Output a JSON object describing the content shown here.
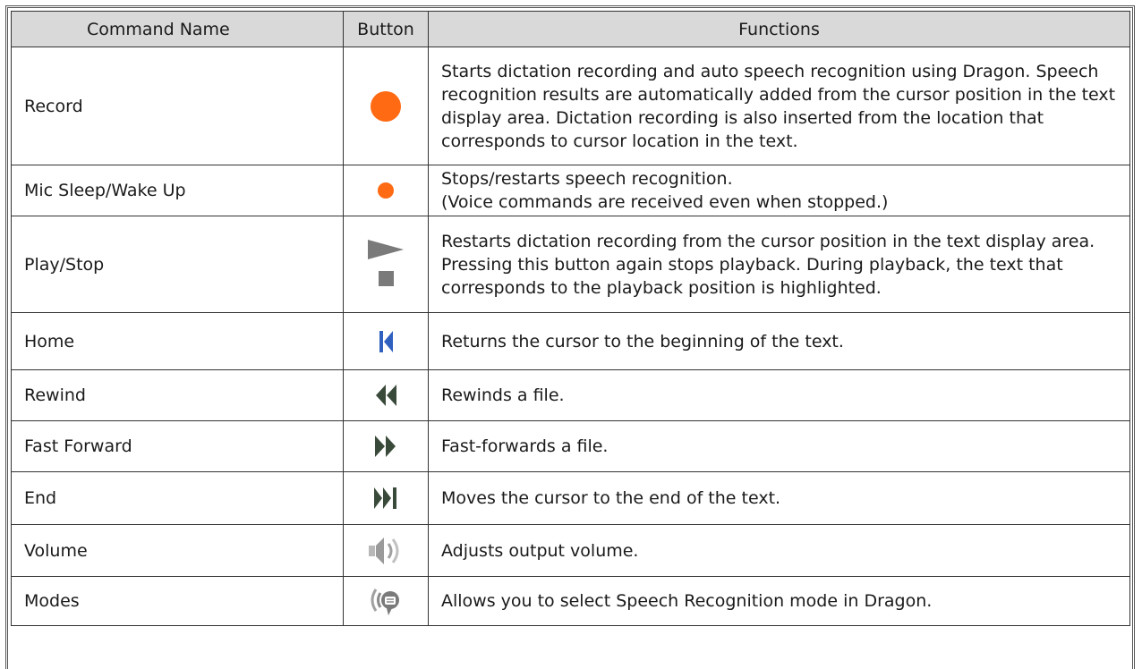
{
  "headers": {
    "command_name": "Command Name",
    "button": "Button",
    "functions": "Functions"
  },
  "rows": [
    {
      "name": "Record",
      "icon": "record-icon",
      "function": "Starts dictation recording and auto speech recognition using Dragon. Speech recognition results are automatically added from the cursor position in the text display area. Dictation recording is also inserted from the location that corresponds to cursor location in the text."
    },
    {
      "name": "Mic Sleep/Wake Up",
      "icon": "mic-sleep-icon",
      "function_lines": [
        "Stops/restarts speech recognition.",
        "(Voice commands are received even when stopped.)"
      ]
    },
    {
      "name": "Play/Stop",
      "icon": "play-stop-icon",
      "function": "Restarts dictation recording from the cursor position in the text display area. Pressing this button again stops playback. During playback, the text that corresponds to the playback position is highlighted."
    },
    {
      "name": "Home",
      "icon": "home-icon",
      "function": "Returns the cursor to the beginning of the text."
    },
    {
      "name": "Rewind",
      "icon": "rewind-icon",
      "function": "Rewinds a file."
    },
    {
      "name": "Fast Forward",
      "icon": "fast-forward-icon",
      "function": "Fast-forwards a file."
    },
    {
      "name": "End",
      "icon": "end-icon",
      "function": "Moves the cursor to the end of the text."
    },
    {
      "name": "Volume",
      "icon": "volume-icon",
      "function": "Adjusts output volume."
    },
    {
      "name": "Modes",
      "icon": "modes-icon",
      "function": "Allows you to select Speech Recognition mode in Dragon."
    }
  ],
  "colors": {
    "header_bg": "#d9d9d9",
    "record_orange": "#ff6a13",
    "play_gray": "#7a7a7a",
    "home_blue": "#2f5fbf",
    "nav_dark": "#3a4a3a"
  }
}
